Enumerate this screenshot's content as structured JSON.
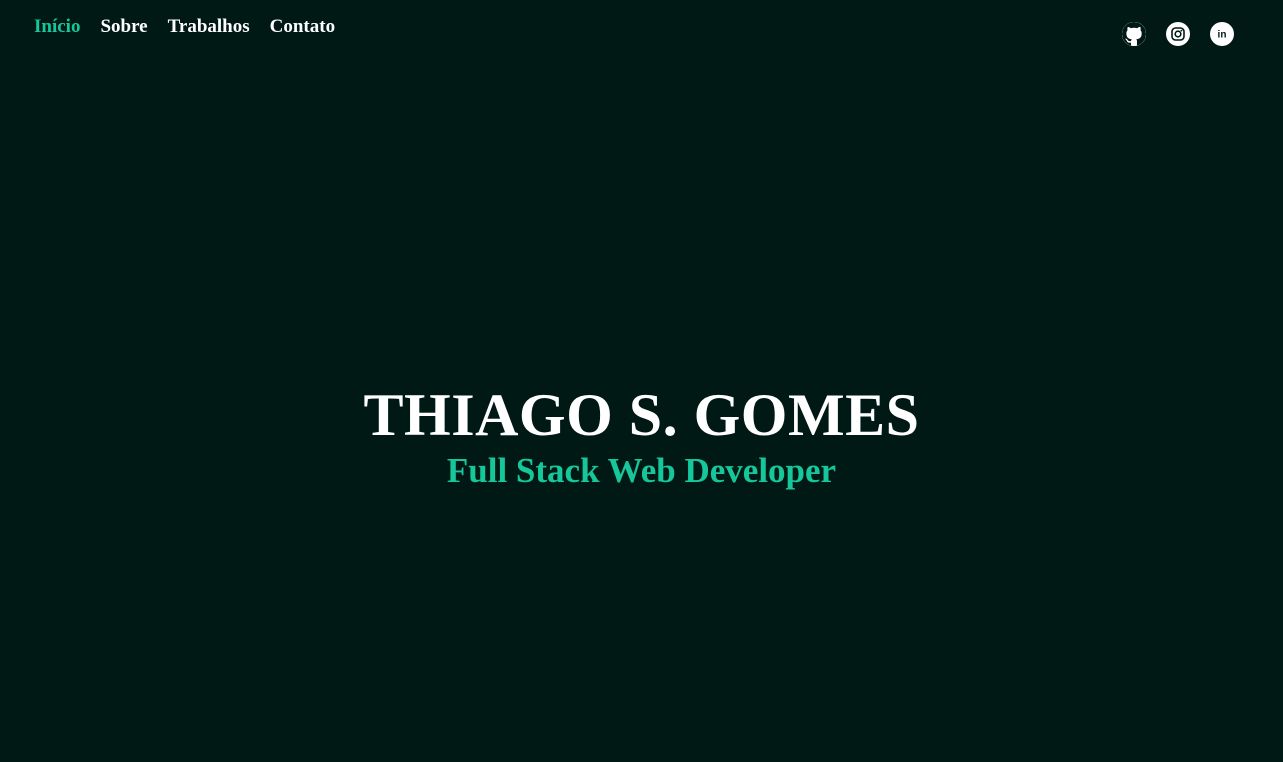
{
  "nav": {
    "items": [
      {
        "label": "Início",
        "active": true
      },
      {
        "label": "Sobre",
        "active": false
      },
      {
        "label": "Trabalhos",
        "active": false
      },
      {
        "label": "Contato",
        "active": false
      }
    ]
  },
  "social": {
    "icons": [
      "github-icon",
      "instagram-icon",
      "linkedin-icon"
    ],
    "linkedin_text": "in"
  },
  "hero": {
    "name": "THIAGO S. GOMES",
    "role": "Full Stack Web Developer"
  },
  "colors": {
    "background": "#001915",
    "accent": "#15c79b",
    "text": "#ffffff"
  }
}
